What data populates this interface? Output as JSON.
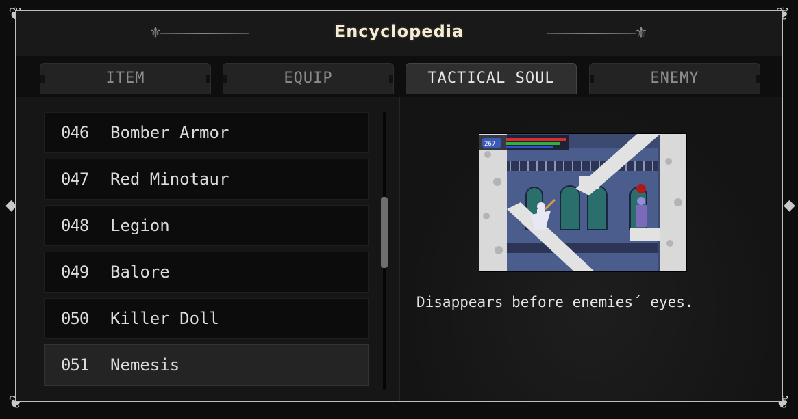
{
  "window": {
    "title": "Encyclopedia"
  },
  "tabs": [
    {
      "label": "ITEM",
      "active": false
    },
    {
      "label": "EQUIP",
      "active": false
    },
    {
      "label": "TACTICAL SOUL",
      "active": true
    },
    {
      "label": "ENEMY",
      "active": false
    }
  ],
  "list": {
    "rows": [
      {
        "num": "046",
        "name": "Bomber Armor"
      },
      {
        "num": "047",
        "name": "Red Minotaur"
      },
      {
        "num": "048",
        "name": "Legion"
      },
      {
        "num": "049",
        "name": "Balore"
      },
      {
        "num": "050",
        "name": "Killer Doll"
      },
      {
        "num": "051",
        "name": "Nemesis"
      }
    ],
    "selected_index": 5
  },
  "detail": {
    "hud_hp": "267",
    "description": "Disappears before enemies´ eyes."
  },
  "colors": {
    "frame_border": "#bfbfbf",
    "title_text": "#f4ecd6",
    "active_tab_text": "#e8e8e8",
    "inactive_tab_text": "#8c8c8c",
    "row_bg": "#0c0c0c",
    "row_selected_bg": "#242424"
  },
  "icons": {
    "corner": "ornate-corner-icon",
    "fleur": "fleur-de-lis-icon"
  }
}
